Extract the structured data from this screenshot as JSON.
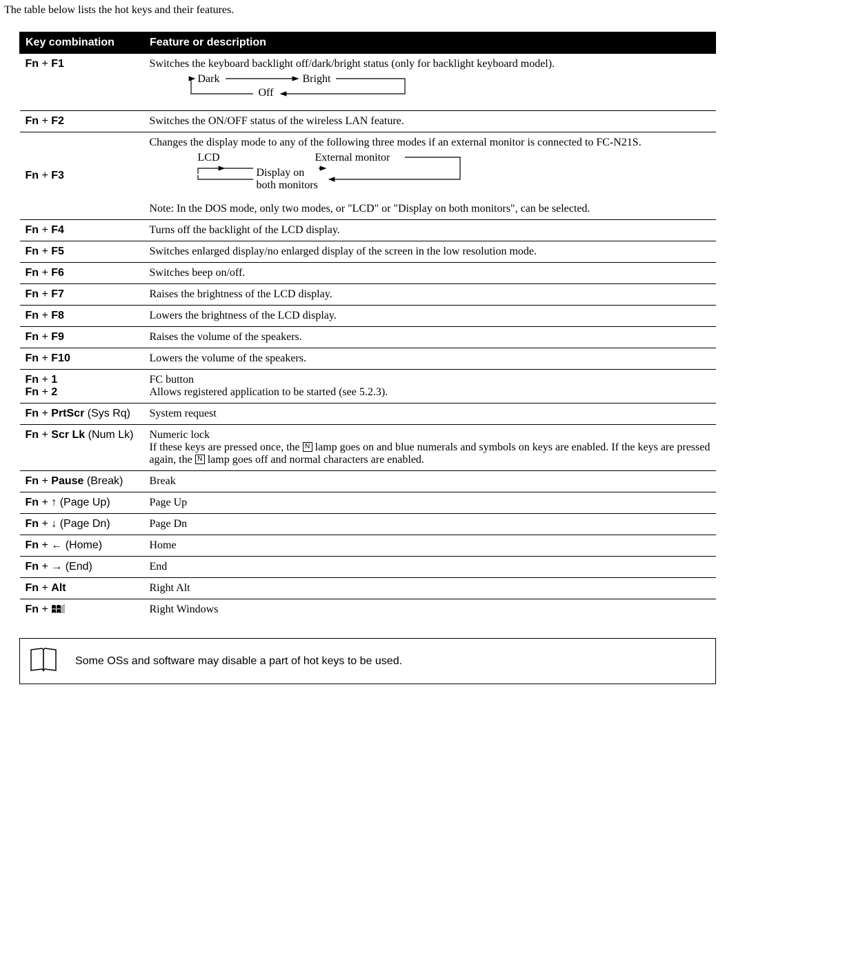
{
  "intro": "The table below lists the hot keys and their features.",
  "headers": {
    "key": "Key combination",
    "feature": "Feature or description"
  },
  "rows": {
    "f1": {
      "key_html": "Fn|+|F1",
      "desc": "Switches the keyboard backlight off/dark/bright status (only for backlight keyboard model).",
      "dark": "Dark",
      "bright": "Bright",
      "off": "Off"
    },
    "f2": {
      "key_html": "Fn|+|F2",
      "desc": "Switches the ON/OFF status of the wireless LAN feature."
    },
    "f3": {
      "key_html": "Fn|+|F3",
      "desc": "Changes the display mode to any of the following three modes if an external monitor is connected to FC-N21S.",
      "lcd": "LCD",
      "ext": "External monitor",
      "both1": "Display on",
      "both2": "both monitors",
      "note": "Note: In the DOS mode, only two modes, or \"LCD\" or \"Display on both monitors\", can be selected."
    },
    "f4": {
      "key_html": "Fn|+|F4",
      "desc": "Turns off the backlight of the LCD display."
    },
    "f5": {
      "key_html": "Fn|+|F5",
      "desc": "Switches enlarged display/no enlarged display of the screen in the low resolution mode."
    },
    "f6": {
      "key_html": "Fn|+|F6",
      "desc": "Switches beep on/off."
    },
    "f7": {
      "key_html": "Fn|+|F7",
      "desc": "Raises the brightness of the LCD display."
    },
    "f8": {
      "key_html": "Fn|+|F8",
      "desc": "Lowers the brightness of the LCD display."
    },
    "f9": {
      "key_html": "Fn|+|F9",
      "desc": "Raises the volume of the speakers."
    },
    "f10": {
      "key_html": "Fn|+|F10",
      "desc": "Lowers the volume of the speakers."
    },
    "fn12": {
      "key1_html": "Fn|+|1",
      "key2_html": "Fn|+|2",
      "desc1": "FC button",
      "desc2": "Allows registered application to be started (see 5.2.3)."
    },
    "prtscr": {
      "key_html": "Fn|+|PrtScr| (Sys Rq)",
      "desc": "System request"
    },
    "scrlk": {
      "key_html": "Fn|+|Scr Lk| (Num Lk)",
      "desc_line1": "Numeric lock",
      "desc_a": "If these keys are pressed once, the ",
      "desc_b": " lamp goes on and blue numerals and symbols on keys are enabled. If the keys are pressed again, the ",
      "desc_c": " lamp goes off and normal characters are enabled.",
      "icon_char": "N"
    },
    "pause": {
      "key_html": "Fn|+|Pause| (Break)",
      "desc": "Break"
    },
    "pgup": {
      "key_pre": "Fn|+|",
      "arrow": "↑",
      "paren": " (Page Up)",
      "desc": "Page Up"
    },
    "pgdn": {
      "key_pre": "Fn|+|",
      "arrow": "↓",
      "paren": " (Page Dn)",
      "desc": "Page Dn"
    },
    "home": {
      "key_pre": "Fn|+|",
      "arrow": "←",
      "paren": " (Home)",
      "desc": "Home"
    },
    "end": {
      "key_pre": "Fn|+|",
      "arrow": "→",
      "paren": " (End)",
      "desc": "End"
    },
    "alt": {
      "key_html": "Fn|+|Alt",
      "desc": "Right Alt"
    },
    "win": {
      "key_pre": "Fn|+|",
      "desc": "Right Windows"
    }
  },
  "footnote": "Some OSs and software may disable a part of hot keys to be used."
}
